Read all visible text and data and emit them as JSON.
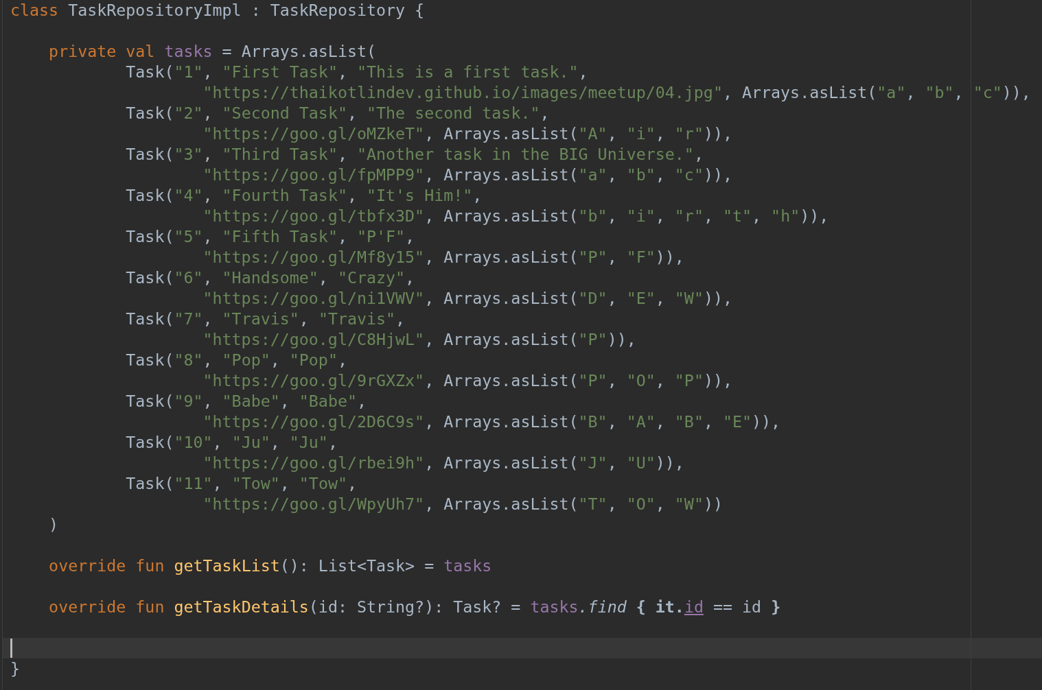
{
  "editor": {
    "lines": [
      {
        "current": false,
        "tokens": [
          {
            "t": "class",
            "kind": "keyword"
          },
          {
            "t": " TaskRepositoryImpl : TaskRepository {",
            "kind": "plain"
          }
        ]
      },
      {
        "current": false
      },
      {
        "current": false,
        "tokens": [
          {
            "t": "    private val ",
            "kind": "keyword"
          },
          {
            "t": "tasks",
            "kind": "field"
          },
          {
            "t": " = Arrays.asList(",
            "kind": "plain"
          }
        ]
      },
      {
        "current": false,
        "tokens": [
          {
            "t": "            Task(",
            "kind": "plain"
          },
          {
            "t": "\"1\"",
            "kind": "string"
          },
          {
            "t": ", ",
            "kind": "plain"
          },
          {
            "t": "\"First Task\"",
            "kind": "string"
          },
          {
            "t": ", ",
            "kind": "plain"
          },
          {
            "t": "\"This is a first task.\"",
            "kind": "string"
          },
          {
            "t": ",",
            "kind": "plain"
          }
        ]
      },
      {
        "current": false,
        "tokens": [
          {
            "t": "                    \"https://thaikotlindev.github.io/images/meetup/04.jpg\"",
            "kind": "string"
          },
          {
            "t": ", Arrays.asList(",
            "kind": "plain"
          },
          {
            "t": "\"a\"",
            "kind": "string"
          },
          {
            "t": ", ",
            "kind": "plain"
          },
          {
            "t": "\"b\"",
            "kind": "string"
          },
          {
            "t": ", ",
            "kind": "plain"
          },
          {
            "t": "\"c\"",
            "kind": "string"
          },
          {
            "t": ")),",
            "kind": "plain"
          }
        ]
      },
      {
        "current": false,
        "tokens": [
          {
            "t": "            Task(",
            "kind": "plain"
          },
          {
            "t": "\"2\"",
            "kind": "string"
          },
          {
            "t": ", ",
            "kind": "plain"
          },
          {
            "t": "\"Second Task\"",
            "kind": "string"
          },
          {
            "t": ", ",
            "kind": "plain"
          },
          {
            "t": "\"The second task.\"",
            "kind": "string"
          },
          {
            "t": ",",
            "kind": "plain"
          }
        ]
      },
      {
        "current": false,
        "tokens": [
          {
            "t": "                    \"https://goo.gl/oMZkeT\"",
            "kind": "string"
          },
          {
            "t": ", Arrays.asList(",
            "kind": "plain"
          },
          {
            "t": "\"A\"",
            "kind": "string"
          },
          {
            "t": ", ",
            "kind": "plain"
          },
          {
            "t": "\"i\"",
            "kind": "string"
          },
          {
            "t": ", ",
            "kind": "plain"
          },
          {
            "t": "\"r\"",
            "kind": "string"
          },
          {
            "t": ")),",
            "kind": "plain"
          }
        ]
      },
      {
        "current": false,
        "tokens": [
          {
            "t": "            Task(",
            "kind": "plain"
          },
          {
            "t": "\"3\"",
            "kind": "string"
          },
          {
            "t": ", ",
            "kind": "plain"
          },
          {
            "t": "\"Third Task\"",
            "kind": "string"
          },
          {
            "t": ", ",
            "kind": "plain"
          },
          {
            "t": "\"Another task in the BIG Universe.\"",
            "kind": "string"
          },
          {
            "t": ",",
            "kind": "plain"
          }
        ]
      },
      {
        "current": false,
        "tokens": [
          {
            "t": "                    \"https://goo.gl/fpMPP9\"",
            "kind": "string"
          },
          {
            "t": ", Arrays.asList(",
            "kind": "plain"
          },
          {
            "t": "\"a\"",
            "kind": "string"
          },
          {
            "t": ", ",
            "kind": "plain"
          },
          {
            "t": "\"b\"",
            "kind": "string"
          },
          {
            "t": ", ",
            "kind": "plain"
          },
          {
            "t": "\"c\"",
            "kind": "string"
          },
          {
            "t": ")),",
            "kind": "plain"
          }
        ]
      },
      {
        "current": false,
        "tokens": [
          {
            "t": "            Task(",
            "kind": "plain"
          },
          {
            "t": "\"4\"",
            "kind": "string"
          },
          {
            "t": ", ",
            "kind": "plain"
          },
          {
            "t": "\"Fourth Task\"",
            "kind": "string"
          },
          {
            "t": ", ",
            "kind": "plain"
          },
          {
            "t": "\"It's Him!\"",
            "kind": "string"
          },
          {
            "t": ",",
            "kind": "plain"
          }
        ]
      },
      {
        "current": false,
        "tokens": [
          {
            "t": "                    \"https://goo.gl/tbfx3D\"",
            "kind": "string"
          },
          {
            "t": ", Arrays.asList(",
            "kind": "plain"
          },
          {
            "t": "\"b\"",
            "kind": "string"
          },
          {
            "t": ", ",
            "kind": "plain"
          },
          {
            "t": "\"i\"",
            "kind": "string"
          },
          {
            "t": ", ",
            "kind": "plain"
          },
          {
            "t": "\"r\"",
            "kind": "string"
          },
          {
            "t": ", ",
            "kind": "plain"
          },
          {
            "t": "\"t\"",
            "kind": "string"
          },
          {
            "t": ", ",
            "kind": "plain"
          },
          {
            "t": "\"h\"",
            "kind": "string"
          },
          {
            "t": ")),",
            "kind": "plain"
          }
        ]
      },
      {
        "current": false,
        "tokens": [
          {
            "t": "            Task(",
            "kind": "plain"
          },
          {
            "t": "\"5\"",
            "kind": "string"
          },
          {
            "t": ", ",
            "kind": "plain"
          },
          {
            "t": "\"Fifth Task\"",
            "kind": "string"
          },
          {
            "t": ", ",
            "kind": "plain"
          },
          {
            "t": "\"P'F\"",
            "kind": "string"
          },
          {
            "t": ",",
            "kind": "plain"
          }
        ]
      },
      {
        "current": false,
        "tokens": [
          {
            "t": "                    \"https://goo.gl/Mf8y15\"",
            "kind": "string"
          },
          {
            "t": ", Arrays.asList(",
            "kind": "plain"
          },
          {
            "t": "\"P\"",
            "kind": "string"
          },
          {
            "t": ", ",
            "kind": "plain"
          },
          {
            "t": "\"F\"",
            "kind": "string"
          },
          {
            "t": ")),",
            "kind": "plain"
          }
        ]
      },
      {
        "current": false,
        "tokens": [
          {
            "t": "            Task(",
            "kind": "plain"
          },
          {
            "t": "\"6\"",
            "kind": "string"
          },
          {
            "t": ", ",
            "kind": "plain"
          },
          {
            "t": "\"Handsome\"",
            "kind": "string"
          },
          {
            "t": ", ",
            "kind": "plain"
          },
          {
            "t": "\"Crazy\"",
            "kind": "string"
          },
          {
            "t": ",",
            "kind": "plain"
          }
        ]
      },
      {
        "current": false,
        "tokens": [
          {
            "t": "                    \"https://goo.gl/ni1VWV\"",
            "kind": "string"
          },
          {
            "t": ", Arrays.asList(",
            "kind": "plain"
          },
          {
            "t": "\"D\"",
            "kind": "string"
          },
          {
            "t": ", ",
            "kind": "plain"
          },
          {
            "t": "\"E\"",
            "kind": "string"
          },
          {
            "t": ", ",
            "kind": "plain"
          },
          {
            "t": "\"W\"",
            "kind": "string"
          },
          {
            "t": ")),",
            "kind": "plain"
          }
        ]
      },
      {
        "current": false,
        "tokens": [
          {
            "t": "            Task(",
            "kind": "plain"
          },
          {
            "t": "\"7\"",
            "kind": "string"
          },
          {
            "t": ", ",
            "kind": "plain"
          },
          {
            "t": "\"Travis\"",
            "kind": "string"
          },
          {
            "t": ", ",
            "kind": "plain"
          },
          {
            "t": "\"Travis\"",
            "kind": "string"
          },
          {
            "t": ",",
            "kind": "plain"
          }
        ]
      },
      {
        "current": false,
        "tokens": [
          {
            "t": "                    \"https://goo.gl/C8HjwL\"",
            "kind": "string"
          },
          {
            "t": ", Arrays.asList(",
            "kind": "plain"
          },
          {
            "t": "\"P\"",
            "kind": "string"
          },
          {
            "t": ")),",
            "kind": "plain"
          }
        ]
      },
      {
        "current": false,
        "tokens": [
          {
            "t": "            Task(",
            "kind": "plain"
          },
          {
            "t": "\"8\"",
            "kind": "string"
          },
          {
            "t": ", ",
            "kind": "plain"
          },
          {
            "t": "\"Pop\"",
            "kind": "string"
          },
          {
            "t": ", ",
            "kind": "plain"
          },
          {
            "t": "\"Pop\"",
            "kind": "string"
          },
          {
            "t": ",",
            "kind": "plain"
          }
        ]
      },
      {
        "current": false,
        "tokens": [
          {
            "t": "                    \"https://goo.gl/9rGXZx\"",
            "kind": "string"
          },
          {
            "t": ", Arrays.asList(",
            "kind": "plain"
          },
          {
            "t": "\"P\"",
            "kind": "string"
          },
          {
            "t": ", ",
            "kind": "plain"
          },
          {
            "t": "\"O\"",
            "kind": "string"
          },
          {
            "t": ", ",
            "kind": "plain"
          },
          {
            "t": "\"P\"",
            "kind": "string"
          },
          {
            "t": ")),",
            "kind": "plain"
          }
        ]
      },
      {
        "current": false,
        "tokens": [
          {
            "t": "            Task(",
            "kind": "plain"
          },
          {
            "t": "\"9\"",
            "kind": "string"
          },
          {
            "t": ", ",
            "kind": "plain"
          },
          {
            "t": "\"Babe\"",
            "kind": "string"
          },
          {
            "t": ", ",
            "kind": "plain"
          },
          {
            "t": "\"Babe\"",
            "kind": "string"
          },
          {
            "t": ",",
            "kind": "plain"
          }
        ]
      },
      {
        "current": false,
        "tokens": [
          {
            "t": "                    \"https://goo.gl/2D6C9s\"",
            "kind": "string"
          },
          {
            "t": ", Arrays.asList(",
            "kind": "plain"
          },
          {
            "t": "\"B\"",
            "kind": "string"
          },
          {
            "t": ", ",
            "kind": "plain"
          },
          {
            "t": "\"A\"",
            "kind": "string"
          },
          {
            "t": ", ",
            "kind": "plain"
          },
          {
            "t": "\"B\"",
            "kind": "string"
          },
          {
            "t": ", ",
            "kind": "plain"
          },
          {
            "t": "\"E\"",
            "kind": "string"
          },
          {
            "t": ")),",
            "kind": "plain"
          }
        ]
      },
      {
        "current": false,
        "tokens": [
          {
            "t": "            Task(",
            "kind": "plain"
          },
          {
            "t": "\"10\"",
            "kind": "string"
          },
          {
            "t": ", ",
            "kind": "plain"
          },
          {
            "t": "\"Ju\"",
            "kind": "string"
          },
          {
            "t": ", ",
            "kind": "plain"
          },
          {
            "t": "\"Ju\"",
            "kind": "string"
          },
          {
            "t": ",",
            "kind": "plain"
          }
        ]
      },
      {
        "current": false,
        "tokens": [
          {
            "t": "                    \"https://goo.gl/rbei9h\"",
            "kind": "string"
          },
          {
            "t": ", Arrays.asList(",
            "kind": "plain"
          },
          {
            "t": "\"J\"",
            "kind": "string"
          },
          {
            "t": ", ",
            "kind": "plain"
          },
          {
            "t": "\"U\"",
            "kind": "string"
          },
          {
            "t": ")),",
            "kind": "plain"
          }
        ]
      },
      {
        "current": false,
        "tokens": [
          {
            "t": "            Task(",
            "kind": "plain"
          },
          {
            "t": "\"11\"",
            "kind": "string"
          },
          {
            "t": ", ",
            "kind": "plain"
          },
          {
            "t": "\"Tow\"",
            "kind": "string"
          },
          {
            "t": ", ",
            "kind": "plain"
          },
          {
            "t": "\"Tow\"",
            "kind": "string"
          },
          {
            "t": ",",
            "kind": "plain"
          }
        ]
      },
      {
        "current": false,
        "tokens": [
          {
            "t": "                    \"https://goo.gl/WpyUh7\"",
            "kind": "string"
          },
          {
            "t": ", Arrays.asList(",
            "kind": "plain"
          },
          {
            "t": "\"T\"",
            "kind": "string"
          },
          {
            "t": ", ",
            "kind": "plain"
          },
          {
            "t": "\"O\"",
            "kind": "string"
          },
          {
            "t": ", ",
            "kind": "plain"
          },
          {
            "t": "\"W\"",
            "kind": "string"
          },
          {
            "t": "))",
            "kind": "plain"
          }
        ]
      },
      {
        "current": false,
        "tokens": [
          {
            "t": "    )",
            "kind": "plain"
          }
        ]
      },
      {
        "current": false
      },
      {
        "current": false,
        "tokens": [
          {
            "t": "    override fun ",
            "kind": "keyword"
          },
          {
            "t": "getTaskList",
            "kind": "function"
          },
          {
            "t": "(): List<Task> = ",
            "kind": "plain"
          },
          {
            "t": "tasks",
            "kind": "field"
          }
        ]
      },
      {
        "current": false
      },
      {
        "current": false,
        "tokens": [
          {
            "t": "    override fun ",
            "kind": "keyword"
          },
          {
            "t": "getTaskDetails",
            "kind": "function"
          },
          {
            "t": "(id: String?): Task? = ",
            "kind": "plain"
          },
          {
            "t": "tasks",
            "kind": "field"
          },
          {
            "t": ".find",
            "kind": "call"
          },
          {
            "t": " { ",
            "kind": "bold"
          },
          {
            "t": "it.",
            "kind": "bold"
          },
          {
            "t": "id",
            "kind": "reference"
          },
          {
            "t": " == id ",
            "kind": "plain"
          },
          {
            "t": "}",
            "kind": "bold"
          }
        ]
      },
      {
        "current": false
      },
      {
        "current": true
      },
      {
        "current": false,
        "tokens": [
          {
            "t": "}",
            "kind": "plain"
          }
        ]
      }
    ]
  }
}
